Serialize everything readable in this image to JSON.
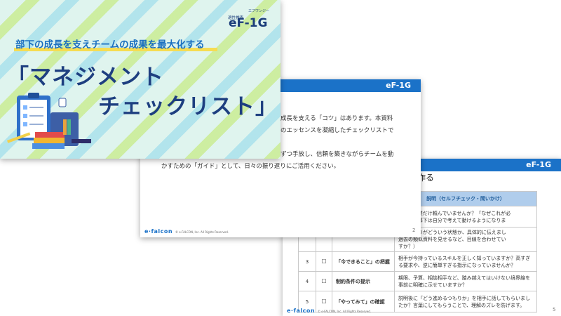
{
  "cover": {
    "brand_small": "適性検査",
    "brand_kana": "エフワンジー",
    "brand": "eF-1G",
    "subtitle": "部下の成長を支えチームの成果を最大化する",
    "title_line1": "「マネジメント",
    "title_line2": "チェックリスト」"
  },
  "slide2": {
    "header_logo": "eF-1G",
    "lines": [
      "成長を支える「コツ」はあります。本資料",
      "のエッセンスを凝縮したチェックリストで",
      "ずつ手放し、信頼を築きながらチームを動",
      "かすための「ガイド」として、日々の振り返りにご活用ください。"
    ],
    "footer_logo": "e·falcon",
    "copyright": "© e-FALCON, Inc. All Rights Reserved.",
    "page": "2"
  },
  "slide3": {
    "header_logo": "eF-1G",
    "heading": "作る",
    "table_header": "説明（セルフチェック・問いかけ）",
    "rows": [
      {
        "num": "",
        "check": "",
        "item": "",
        "desc": "ばして作業だけ頼んでいませんか？「なぜこれが必\n話すと、部下は自分で考えて動けるようになりま"
      },
      {
        "num": "",
        "check": "",
        "item": "",
        "desc": "の仕上がりがどういう状態か、具体的に伝えまし\n過去の類似資料を見せるなど、目線を合わせてい\nすか？）"
      },
      {
        "num": "3",
        "check": "☐",
        "item": "「今できること」の把握",
        "desc": "相手が今持っているスキルを正しく知っていますか？高すぎる要求や、逆に簡単すぎる指示になっていませんか？"
      },
      {
        "num": "4",
        "check": "☐",
        "item": "制約条件の提示",
        "desc": "期限、予算、相談相手など、踏み越えてはいけない境界線を事前に明確に示せていますか？"
      },
      {
        "num": "5",
        "check": "☐",
        "item": "「やってみて」の確認",
        "desc": "説明後に「どう進めるつもりか」を相手に話してもらいましたか？言葉にしてもらうことで、理解のズレを防げます。"
      }
    ],
    "footer_logo": "e·falcon",
    "copyright": "© e-FALCON, Inc. All Rights Reserved.",
    "page": "5"
  }
}
